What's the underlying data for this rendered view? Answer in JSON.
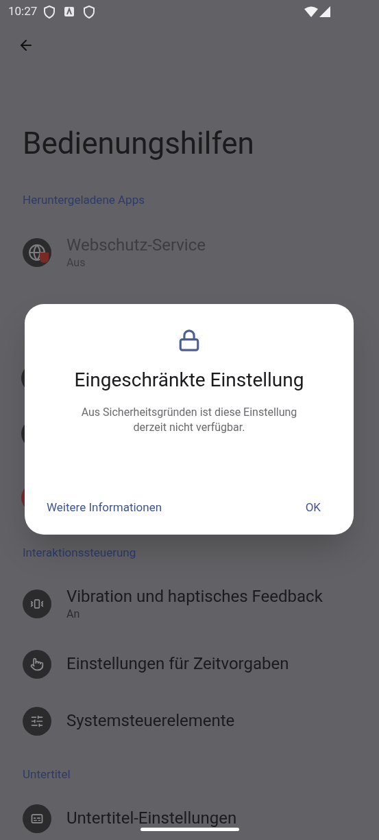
{
  "status_bar": {
    "time": "10:27"
  },
  "page": {
    "title": "Bedienungshilfen"
  },
  "sections": [
    {
      "header": "Heruntergeladene Apps",
      "items": [
        {
          "kind": "globe",
          "title": "Webschutz-Service",
          "subtitle": "Aus",
          "disabled": true
        }
      ]
    },
    {
      "header": "Interaktionssteuerung",
      "items": [
        {
          "kind": "vibration",
          "title": "Vibration und haptisches Feedback",
          "subtitle": "An",
          "disabled": false
        },
        {
          "kind": "touch",
          "title": "Einstellungen für Zeitvorgaben",
          "disabled": false
        },
        {
          "kind": "sliders",
          "title": "Systemsteuerelemente",
          "disabled": false
        }
      ]
    },
    {
      "header": "Untertitel",
      "items": [
        {
          "kind": "captions",
          "title": "Untertitel-Einstellungen",
          "disabled": false
        }
      ]
    }
  ],
  "dialog": {
    "title": "Eingeschränkte Einstellung",
    "message": "Aus Sicherheitsgründen ist diese Einstellung derzeit nicht verfügbar.",
    "buttons": [
      "Weitere Informationen",
      "OK"
    ]
  }
}
